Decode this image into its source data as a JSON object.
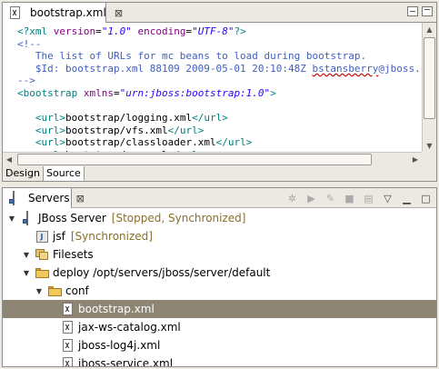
{
  "editor": {
    "tab_title": "bootstrap.xml",
    "tab_close": "⊠",
    "code_lines": [
      [
        {
          "c": "xml-tag",
          "t": "<?xml "
        },
        {
          "c": "xml-attr",
          "t": "version"
        },
        {
          "c": "xml-text",
          "t": "="
        },
        {
          "c": "xml-val",
          "t": "\"1.0\""
        },
        {
          "c": "xml-text",
          "t": " "
        },
        {
          "c": "xml-attr",
          "t": "encoding"
        },
        {
          "c": "xml-text",
          "t": "="
        },
        {
          "c": "xml-val",
          "t": "\"UTF-8\""
        },
        {
          "c": "xml-tag",
          "t": "?>"
        }
      ],
      [
        {
          "c": "xml-com",
          "t": "<!--"
        }
      ],
      [
        {
          "c": "xml-com",
          "t": "   The list of URLs for mc beans to load during bootstrap."
        }
      ],
      [
        {
          "c": "xml-com",
          "t": "   $Id: bootstrap.xml 88109 2009-05-01 20:10:48Z "
        },
        {
          "c": "xml-com underline-err",
          "t": "bstansberry"
        },
        {
          "c": "xml-com",
          "t": "@jboss.c"
        }
      ],
      [
        {
          "c": "xml-com",
          "t": "-->"
        }
      ],
      [
        {
          "c": "xml-tag",
          "t": "<bootstrap "
        },
        {
          "c": "xml-attr",
          "t": "xmlns"
        },
        {
          "c": "xml-text",
          "t": "="
        },
        {
          "c": "xml-val",
          "t": "\"urn:jboss:bootstrap:1.0\""
        },
        {
          "c": "xml-tag",
          "t": ">"
        }
      ],
      [
        {
          "c": "xml-text",
          "t": ""
        }
      ],
      [
        {
          "c": "xml-text",
          "t": "   "
        },
        {
          "c": "xml-tag",
          "t": "<url>"
        },
        {
          "c": "xml-text",
          "t": "bootstrap/logging.xml"
        },
        {
          "c": "xml-tag",
          "t": "</url>"
        }
      ],
      [
        {
          "c": "xml-text",
          "t": "   "
        },
        {
          "c": "xml-tag",
          "t": "<url>"
        },
        {
          "c": "xml-text",
          "t": "bootstrap/vfs.xml"
        },
        {
          "c": "xml-tag",
          "t": "</url>"
        }
      ],
      [
        {
          "c": "xml-text",
          "t": "   "
        },
        {
          "c": "xml-tag",
          "t": "<url>"
        },
        {
          "c": "xml-text",
          "t": "bootstrap/classloader.xml"
        },
        {
          "c": "xml-tag",
          "t": "</url>"
        }
      ],
      [
        {
          "c": "xml-text",
          "t": "   "
        },
        {
          "c": "xml-tag",
          "t": "<url>"
        },
        {
          "c": "xml-text",
          "t": "bootstrap/aop.xml"
        },
        {
          "c": "xml-tag",
          "t": "</url>"
        }
      ]
    ],
    "mode_tabs": [
      "Design",
      "Source"
    ],
    "active_mode": "Source"
  },
  "servers_view": {
    "tab_title": "Servers",
    "tab_close": "⊠",
    "toolbar_icons": [
      "debug-icon",
      "start-icon",
      "profile-icon",
      "stop-icon",
      "publish-icon",
      "minimize-view-icon",
      "maximize-view-icon"
    ],
    "tree": [
      {
        "level": 0,
        "twisty": "▼",
        "icon": "server",
        "label": "JBoss Server",
        "decoration": "[Stopped, Synchronized]"
      },
      {
        "level": 1,
        "twisty": "",
        "icon": "module",
        "label": "jsf",
        "decoration": "[Synchronized]"
      },
      {
        "level": 1,
        "twisty": "▼",
        "icon": "filesets",
        "label": "Filesets",
        "decoration": ""
      },
      {
        "level": 2,
        "twisty": "▼",
        "icon": "folder",
        "label": "deploy  /opt/servers/jboss/server/default",
        "decoration": ""
      },
      {
        "level": 3,
        "twisty": "▼",
        "icon": "folder",
        "label": "conf",
        "decoration": ""
      },
      {
        "level": 4,
        "twisty": "",
        "icon": "xml",
        "label": "bootstrap.xml",
        "decoration": "",
        "selected": true
      },
      {
        "level": 4,
        "twisty": "",
        "icon": "xml",
        "label": "jax-ws-catalog.xml",
        "decoration": ""
      },
      {
        "level": 4,
        "twisty": "",
        "icon": "xml",
        "label": "jboss-log4j.xml",
        "decoration": ""
      },
      {
        "level": 4,
        "twisty": "",
        "icon": "xml",
        "label": "jboss-service.xml",
        "decoration": ""
      }
    ]
  }
}
